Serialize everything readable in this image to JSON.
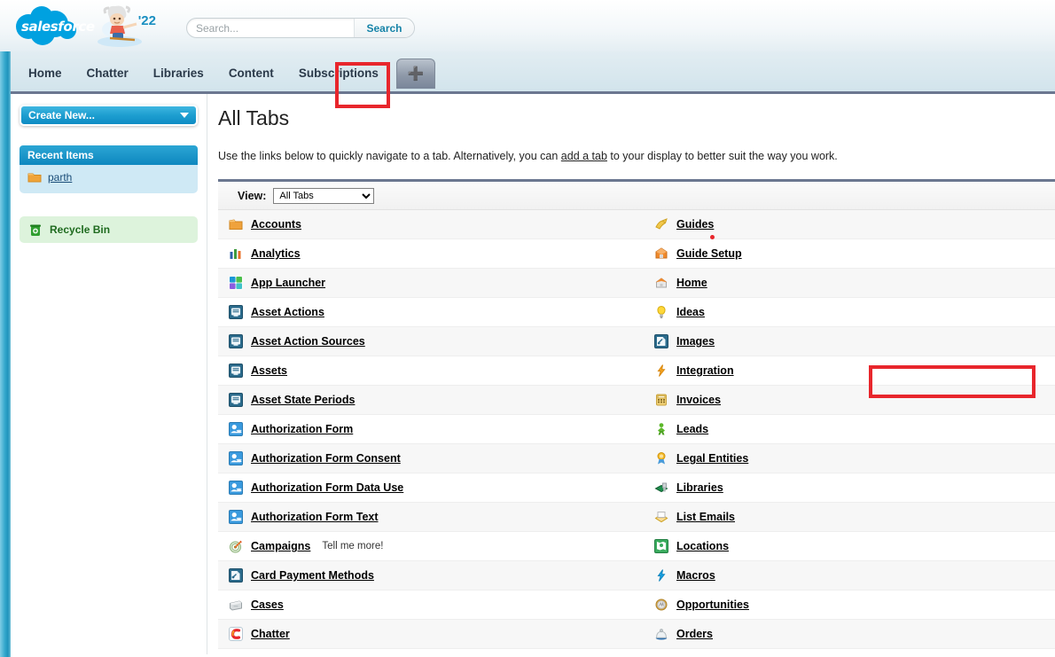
{
  "header": {
    "logo_text": "salesforce",
    "logo_icon": "salesforce-cloud-logo",
    "mascot_icon": "einstein-waterski-mascot",
    "release_year": "'22",
    "search": {
      "placeholder": "Search...",
      "value": "",
      "button_label": "Search"
    }
  },
  "navigation": {
    "tabs": [
      {
        "label": "Home"
      },
      {
        "label": "Chatter"
      },
      {
        "label": "Libraries"
      },
      {
        "label": "Content"
      },
      {
        "label": "Subscriptions"
      }
    ],
    "plus_tab": {
      "icon": "plus-icon",
      "label": "+"
    }
  },
  "sidebar": {
    "create_new": {
      "label": "Create New...",
      "caret_icon": "chevron-down-icon"
    },
    "recent_items": {
      "title": "Recent Items",
      "items": [
        {
          "label": "parth",
          "icon": "folder-icon"
        }
      ]
    },
    "recycle_bin": {
      "label": "Recycle Bin",
      "icon": "recycle-bin-icon"
    }
  },
  "main": {
    "title": "All Tabs",
    "description_before": "Use the links below to quickly navigate to a tab. Alternatively, you can ",
    "description_link": "add a tab",
    "description_after": " to your display to better suit the way you work.",
    "view": {
      "label": "View:",
      "selected": "All Tabs",
      "options": [
        "All Tabs"
      ]
    },
    "columns": {
      "left": [
        {
          "label": "Accounts",
          "icon": "folder-orange-icon"
        },
        {
          "label": "Analytics",
          "icon": "bar-chart-icon"
        },
        {
          "label": "App Launcher",
          "icon": "app-launcher-grid-icon"
        },
        {
          "label": "Asset Actions",
          "icon": "asset-action-icon"
        },
        {
          "label": "Asset Action Sources",
          "icon": "asset-action-source-icon"
        },
        {
          "label": "Assets",
          "icon": "asset-icon"
        },
        {
          "label": "Asset State Periods",
          "icon": "asset-state-period-icon"
        },
        {
          "label": "Authorization Form",
          "icon": "person-card-icon"
        },
        {
          "label": "Authorization Form Consent",
          "icon": "person-card-icon"
        },
        {
          "label": "Authorization Form Data Use",
          "icon": "person-card-icon"
        },
        {
          "label": "Authorization Form Text",
          "icon": "person-card-icon"
        },
        {
          "label": "Campaigns",
          "icon": "target-dart-icon",
          "hint": "Tell me more!"
        },
        {
          "label": "Card Payment Methods",
          "icon": "card-payment-icon"
        },
        {
          "label": "Cases",
          "icon": "briefcase-icon"
        },
        {
          "label": "Chatter",
          "icon": "chatter-c-icon"
        }
      ],
      "right": [
        {
          "label": "Guides",
          "icon": "guides-icon"
        },
        {
          "label": "Guide Setup",
          "icon": "guide-setup-icon"
        },
        {
          "label": "Home",
          "icon": "house-icon"
        },
        {
          "label": "Ideas",
          "icon": "lightbulb-icon"
        },
        {
          "label": "Images",
          "icon": "image-file-icon"
        },
        {
          "label": "Integration",
          "icon": "lightning-bolt-orange-icon"
        },
        {
          "label": "Invoices",
          "icon": "calculator-icon"
        },
        {
          "label": "Leads",
          "icon": "lead-person-icon"
        },
        {
          "label": "Legal Entities",
          "icon": "award-ribbon-icon"
        },
        {
          "label": "Libraries",
          "icon": "library-icon"
        },
        {
          "label": "List Emails",
          "icon": "envelope-icon"
        },
        {
          "label": "Locations",
          "icon": "location-map-icon"
        },
        {
          "label": "Macros",
          "icon": "lightning-bolt-blue-icon"
        },
        {
          "label": "Opportunities",
          "icon": "coin-icon"
        },
        {
          "label": "Orders",
          "icon": "order-bell-icon"
        }
      ]
    }
  },
  "annotations": {
    "highlight_color": "#e8262c",
    "boxes": [
      {
        "target": "plus-tab"
      },
      {
        "target": "integration-row"
      }
    ],
    "cursor_dot": {
      "color": "#e8262c"
    }
  }
}
